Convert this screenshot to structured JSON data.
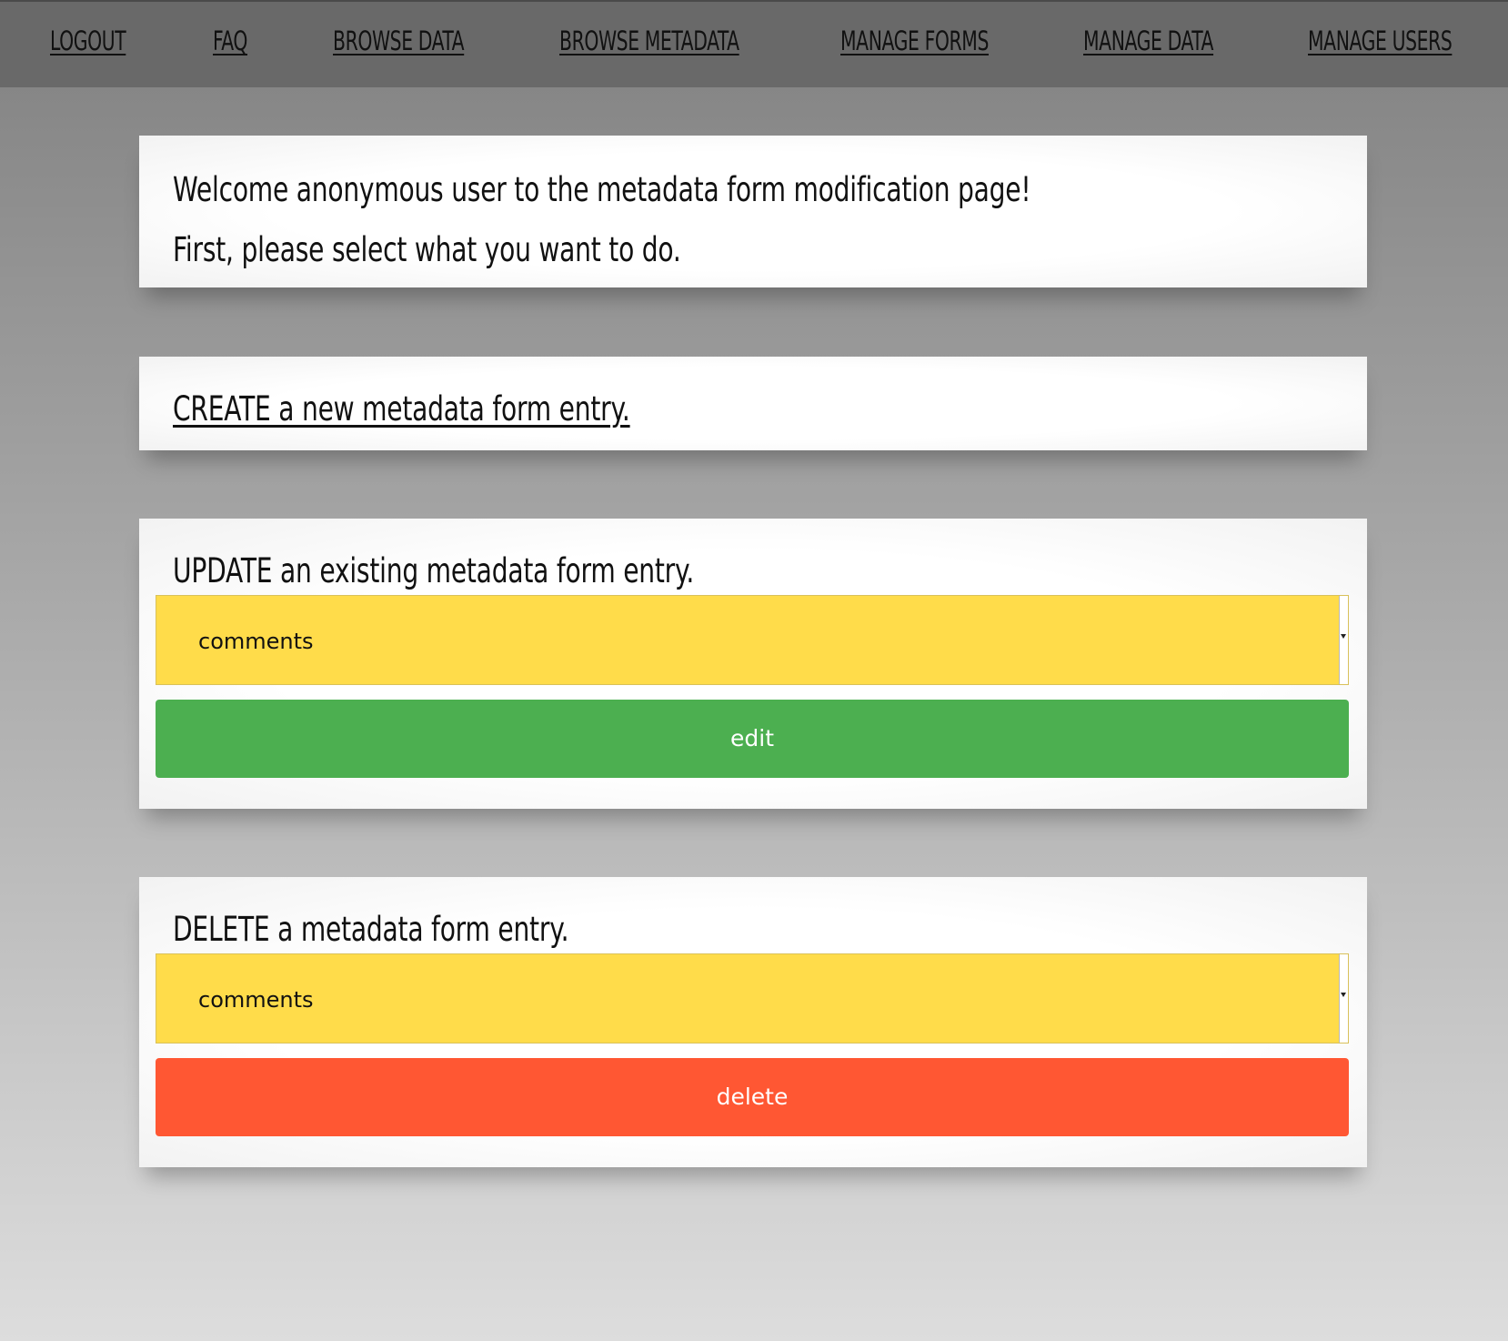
{
  "nav": {
    "items": [
      {
        "label": "LOGOUT"
      },
      {
        "label": "FAQ"
      },
      {
        "label": "BROWSE DATA"
      },
      {
        "label": "BROWSE METADATA"
      },
      {
        "label": "MANAGE FORMS"
      },
      {
        "label": "MANAGE DATA"
      },
      {
        "label": "MANAGE USERS"
      }
    ]
  },
  "welcome": {
    "line1": "Welcome anonymous user to the metadata form modification page!",
    "line2": "First, please select what you want to do."
  },
  "create": {
    "link_label": "CREATE a new metadata form entry."
  },
  "update": {
    "heading": "UPDATE an existing metadata form entry.",
    "selected": "comments",
    "button_label": "edit"
  },
  "delete": {
    "heading": "DELETE a metadata form entry.",
    "selected": "comments",
    "button_label": "delete"
  },
  "colors": {
    "navbar": "#696969",
    "select": "#ffdc4a",
    "edit": "#4caf50",
    "delete": "#ff5733"
  }
}
